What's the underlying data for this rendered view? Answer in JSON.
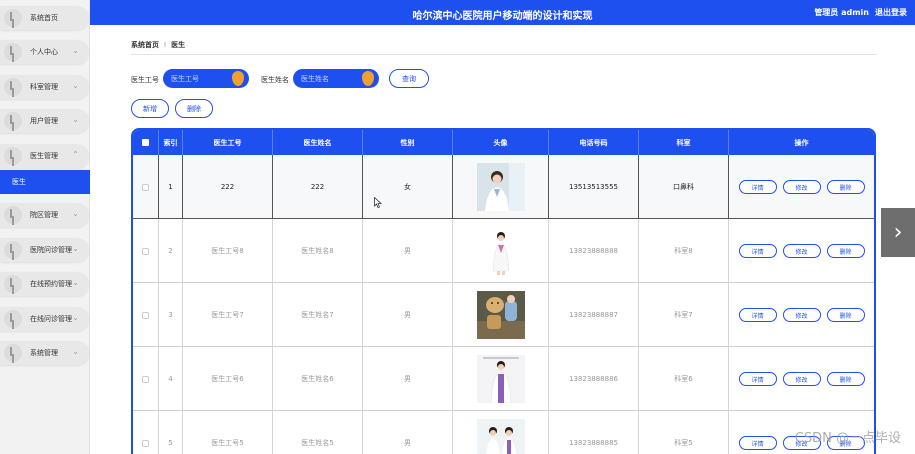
{
  "header": {
    "title": "哈尔滨中心医院用户移动端的设计和实现",
    "user_label": "管理员 admin",
    "logout_label": "退出登录"
  },
  "sidebar": {
    "items": [
      {
        "label": "系统首页",
        "arrow": ""
      },
      {
        "label": "个人中心",
        "arrow": "⌄"
      },
      {
        "label": "科室管理",
        "arrow": "⌄"
      },
      {
        "label": "用户管理",
        "arrow": "⌄"
      },
      {
        "label": "医生管理",
        "arrow": "⌃"
      },
      {
        "label": "院区管理",
        "arrow": "⌄"
      },
      {
        "label": "医院问诊管理",
        "arrow": "⌄"
      },
      {
        "label": "在线预约管理",
        "arrow": "⌄"
      },
      {
        "label": "在线问诊管理",
        "arrow": "⌄"
      },
      {
        "label": "系统管理",
        "arrow": "⌄"
      }
    ],
    "active_sub": "医生"
  },
  "breadcrumb": {
    "home": "系统首页",
    "sep": "I",
    "current": "医生"
  },
  "search": {
    "doc_id_label": "医生工号",
    "doc_id_placeholder": "医生工号",
    "doc_name_label": "医生姓名",
    "doc_name_placeholder": "医生姓名",
    "query_label": "查询"
  },
  "toolbar": {
    "add_label": "新增",
    "delete_label": "删除"
  },
  "table": {
    "headers": [
      "索引",
      "医生工号",
      "医生姓名",
      "性别",
      "头像",
      "电话号码",
      "科室",
      "操作"
    ],
    "rows": [
      {
        "index": "1",
        "id": "222",
        "name": "222",
        "gender": "女",
        "phone": "13513513555",
        "dept": "口鼻科"
      },
      {
        "index": "2",
        "id": "医生工号8",
        "name": "医生姓名8",
        "gender": "男",
        "phone": "13823888888",
        "dept": "科室8"
      },
      {
        "index": "3",
        "id": "医生工号7",
        "name": "医生姓名7",
        "gender": "男",
        "phone": "13823888887",
        "dept": "科室7"
      },
      {
        "index": "4",
        "id": "医生工号6",
        "name": "医生姓名6",
        "gender": "男",
        "phone": "13823888886",
        "dept": "科室6"
      },
      {
        "index": "5",
        "id": "医生工号5",
        "name": "医生姓名5",
        "gender": "男",
        "phone": "13823888885",
        "dept": "科室5"
      }
    ],
    "actions": {
      "detail": "详情",
      "edit": "修改",
      "delete": "删除"
    }
  },
  "nav": {
    "next_arrow": "›"
  },
  "watermark": "CSDN @一点毕设",
  "colors": {
    "primary": "#1e50f0",
    "accent": "#f0a030"
  }
}
